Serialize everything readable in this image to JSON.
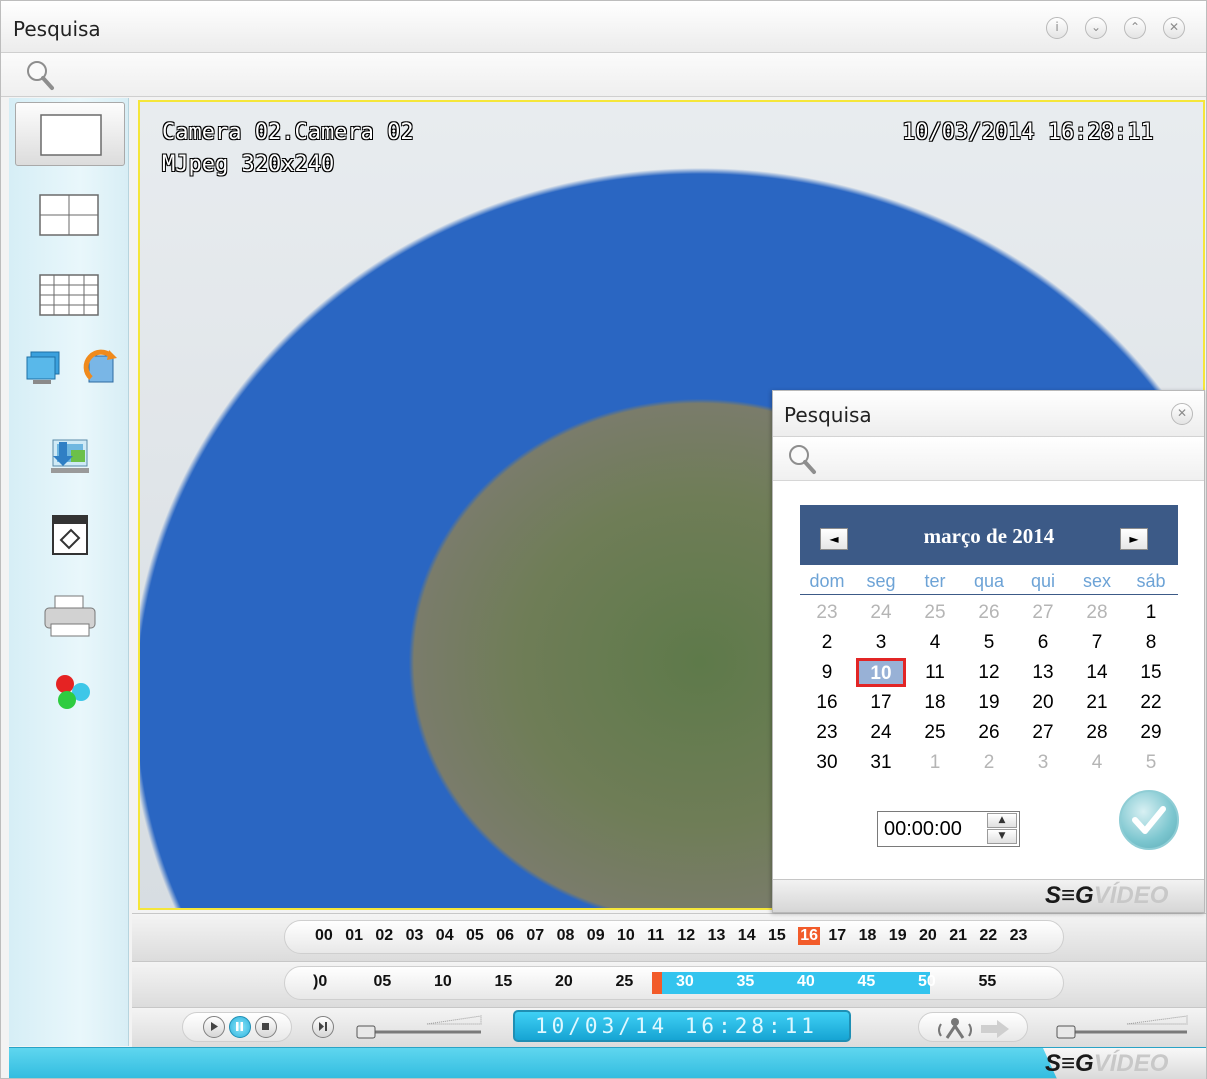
{
  "window": {
    "title": "Pesquisa"
  },
  "video": {
    "camera_label": "Camera 02.Camera 02",
    "stream_info": "MJpeg 320x240",
    "timestamp": "10/03/2014 16:28:11"
  },
  "timeline": {
    "hours": [
      "00",
      "01",
      "02",
      "03",
      "04",
      "05",
      "06",
      "07",
      "08",
      "09",
      "10",
      "11",
      "12",
      "13",
      "14",
      "15",
      "16",
      "17",
      "18",
      "19",
      "20",
      "21",
      "22",
      "23"
    ],
    "active_hour": "16",
    "minute_ticks": [
      "00",
      "05",
      "10",
      "15",
      "20",
      "25",
      "30",
      "35",
      "40",
      "45",
      "50",
      "55"
    ],
    "minute_ticks_display": [
      ")0",
      "05",
      "10",
      "15",
      "20",
      "25",
      "30",
      "35",
      "40",
      "45",
      "50",
      "55"
    ],
    "recorded_range_minutes": [
      28,
      51
    ]
  },
  "playback": {
    "lcd_text": "10/03/14  16:28:11"
  },
  "brand": {
    "seg": "S≡G",
    "video": "VÍDEO"
  },
  "dialog": {
    "title": "Pesquisa",
    "calendar": {
      "month_label": "março de 2014",
      "prev_label": "◄",
      "next_label": "►",
      "weekdays": [
        "dom",
        "seg",
        "ter",
        "qua",
        "qui",
        "sex",
        "sáb"
      ],
      "weeks": [
        [
          "23",
          "24",
          "25",
          "26",
          "27",
          "28",
          "1"
        ],
        [
          "2",
          "3",
          "4",
          "5",
          "6",
          "7",
          "8"
        ],
        [
          "9",
          "10",
          "11",
          "12",
          "13",
          "14",
          "15"
        ],
        [
          "16",
          "17",
          "18",
          "19",
          "20",
          "21",
          "22"
        ],
        [
          "23",
          "24",
          "25",
          "26",
          "27",
          "28",
          "29"
        ],
        [
          "30",
          "31",
          "1",
          "2",
          "3",
          "4",
          "5"
        ]
      ],
      "selected_day": "10"
    },
    "time_value": "00:00:00"
  },
  "colors": {
    "accent": "#3c5a87",
    "active_hour": "#f25b2a",
    "range": "#33c4ee",
    "selection_border": "#e22525"
  }
}
